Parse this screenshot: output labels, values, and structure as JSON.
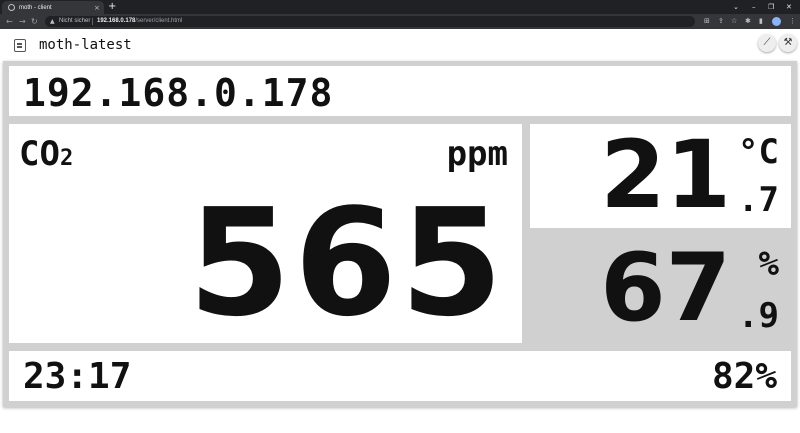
{
  "browser": {
    "tab_title": "moth - client",
    "tab_close": "×",
    "new_tab": "+",
    "security_label": "Nicht sicher",
    "url_host": "192.168.0.178",
    "url_path": "/server/client.html"
  },
  "app": {
    "title": "moth-latest",
    "chart_button_icon": "chart-icon",
    "tools_button_icon": "tools-icon"
  },
  "dashboard": {
    "ip": "192.168.0.178",
    "co2_label": "CO",
    "co2_subscript": "2",
    "co2_unit": "ppm",
    "co2_value": "565",
    "temperature_int": "21",
    "temperature_unit": "°C",
    "temperature_dec": ".7",
    "humidity_int": "67",
    "humidity_unit": "%",
    "humidity_dec": ".9",
    "time": "23:17",
    "battery": "82%"
  },
  "colors": {
    "background": "#ffffff",
    "frame": "#d0d0d0",
    "highlight_panel": "#d0d0d0",
    "text": "#111111",
    "browser_dark": "#202124"
  }
}
